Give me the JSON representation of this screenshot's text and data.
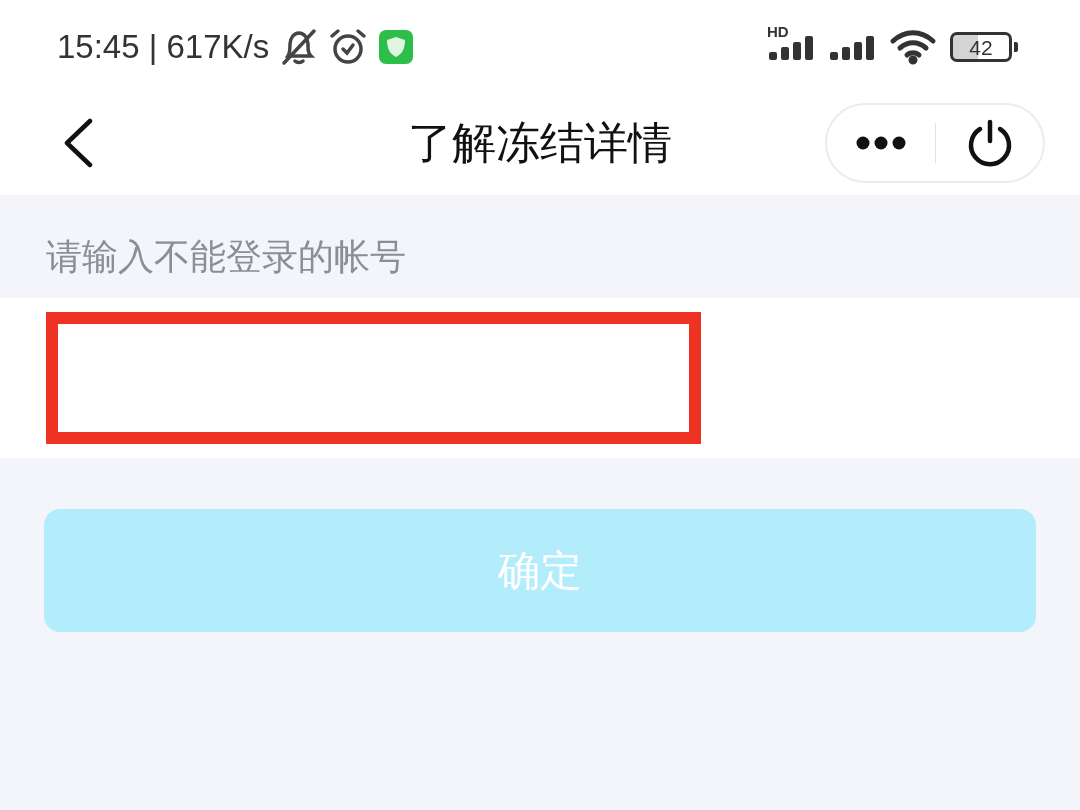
{
  "status_bar": {
    "time_speed": "15:45 | 617K/s",
    "network_label": "HD",
    "battery": "42"
  },
  "header": {
    "title": "了解冻结详情"
  },
  "form": {
    "label": "请输入不能登录的帐号",
    "input": {
      "highlighted": true
    }
  },
  "confirm_button": {
    "label": "确定",
    "disabled": true
  }
}
